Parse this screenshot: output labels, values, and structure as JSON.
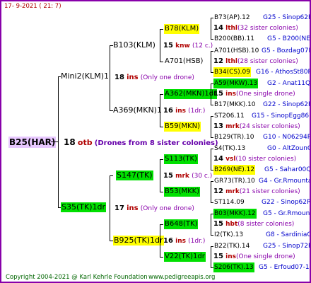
{
  "header": {
    "date": "17-  9-2021 (  21:  7)"
  },
  "root": {
    "label": "B25(HAR)",
    "inbreeding_num": "18",
    "inbreeding_unit": "otb",
    "note": "(Drones from 8 sister colonies)"
  },
  "gen1": [
    {
      "label": "Mini2(KLM)1",
      "num": "18",
      "unit": "ins",
      "note": "(Only one drone)"
    },
    {
      "label": "S35(TK)1dr",
      "num": "17",
      "unit": "ins",
      "note": "(Only one drone)"
    }
  ],
  "gen2": [
    {
      "label": "B103(KLM)",
      "num": "15",
      "unit": "knw",
      "note": "(12 c.)"
    },
    {
      "label": "A369(MKN)1",
      "num": "16",
      "unit": "ins",
      "note": "(1dr.)"
    },
    {
      "label": "S147(TK)",
      "num": "15",
      "unit": "mrk",
      "note": "(30 c.)"
    },
    {
      "label": "B925(TK)1dr",
      "num": "16",
      "unit": "ins",
      "note": "(1dr.)"
    }
  ],
  "gen3": [
    {
      "label": "B78(KLM)",
      "num": "14",
      "unit": "lthl",
      "note": "(32 sister colonies)"
    },
    {
      "label": "A701(HSB)",
      "num": "12",
      "unit": "lthl",
      "note": "(28 sister colonies)"
    },
    {
      "label": "A362(MKN)1dr",
      "num": "15",
      "unit": "ins",
      "note": "(One single drone)"
    },
    {
      "label": "B59(MKN)",
      "num": "13",
      "unit": "mrk",
      "note": "(24 sister colonies)"
    },
    {
      "label": "S113(TK)",
      "num": "14",
      "unit": "vsl",
      "note": "(10 sister colonies)"
    },
    {
      "label": "B53(MKK)",
      "num": "12",
      "unit": "mrk",
      "note": "(21 sister colonies)"
    },
    {
      "label": "B648(TK)",
      "num": "15",
      "unit": "hbt",
      "note": "(8 sister colonies)"
    },
    {
      "label": "V22(TK)1dr",
      "num": "15",
      "unit": "ins",
      "note": "(One single drone)"
    }
  ],
  "gen4": [
    {
      "label": "B73(AP).12",
      "code": "G25 - Sinop62R"
    },
    {
      "label": "B200(BB).11",
      "code": "G5 - B200(NE)"
    },
    {
      "label": "A701(HSB).10",
      "code": "G5 - Bozdag07R"
    },
    {
      "label": "B34(CS).09",
      "code": "G16 - AthosSt80R"
    },
    {
      "label": "A59(MKW).13",
      "code": "G2 - Anat11Q"
    },
    {
      "label": "B17(MKK).10",
      "code": "G22 - Sinop62R"
    },
    {
      "label": "ST206.11",
      "code": "G15 - SinopEgg86R"
    },
    {
      "label": "B129(TR).10",
      "code": "G10 - N06294R"
    },
    {
      "label": "S4(TK).13",
      "code": "G0 - AltZounQ"
    },
    {
      "label": "B269(NE).12",
      "code": "G5 - Sahar00Q"
    },
    {
      "label": "GR73(TR).10",
      "code": "G4 - Gr.Rmounta"
    },
    {
      "label": "ST114.09",
      "code": "G22 - Sinop62R"
    },
    {
      "label": "B03(MKK).12",
      "code": "G5 - Gr.Rmounta"
    },
    {
      "label": "I2(TK).13",
      "code": "G8 - SardiniaQ"
    },
    {
      "label": "B22(TK).14",
      "code": "G25 - Sinop72R"
    },
    {
      "label": "S206(TK).13",
      "code": "G5 - Erfoud07-1Q"
    }
  ],
  "footer": {
    "copyright": "Copyright 2004-2021 @ Karl Kehrle Foundation",
    "site": "www.pedigreeapis.org"
  },
  "colors": {
    "yellow": "#ffff00",
    "green": "#00e000",
    "violet": "#e8c8ff",
    "frame": "#8800aa"
  }
}
